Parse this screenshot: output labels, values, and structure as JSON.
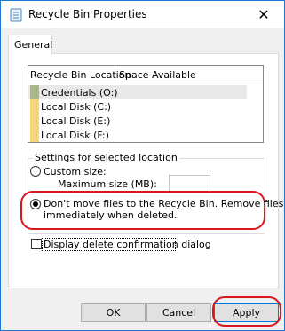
{
  "window": {
    "title": "Recycle Bin Properties",
    "close_glyph": "✕"
  },
  "tabs": [
    {
      "label": "General",
      "selected": true
    }
  ],
  "list": {
    "columns": [
      "Recycle Bin Location",
      "Space Available"
    ],
    "rows": [
      {
        "name": "Credentials (O:)",
        "space": "",
        "selected": true,
        "icon": "drive-icon-green"
      },
      {
        "name": "Local Disk (C:)",
        "space": "",
        "selected": false,
        "icon": "drive-icon-yellow"
      },
      {
        "name": "Local Disk (E:)",
        "space": "",
        "selected": false,
        "icon": "drive-icon-yellow"
      },
      {
        "name": "Local Disk (F:)",
        "space": "",
        "selected": false,
        "icon": "drive-icon-yellow"
      }
    ]
  },
  "settings": {
    "group_title": "Settings for selected location",
    "custom_size_label": "Custom size:",
    "max_size_label": "Maximum size (MB):",
    "max_size_value": "",
    "dont_move_label_line1": "Don't move files to the Recycle Bin. Remove files",
    "dont_move_label_line2": "immediately when deleted.",
    "selected_option": "dont_move",
    "confirm_dialog_label": "Display delete confirmation dialog",
    "confirm_dialog_checked": false
  },
  "buttons": {
    "ok": "OK",
    "cancel": "Cancel",
    "apply": "Apply"
  },
  "colors": {
    "annotation_red": "#d6191f",
    "title_border": "#1f78d0"
  }
}
